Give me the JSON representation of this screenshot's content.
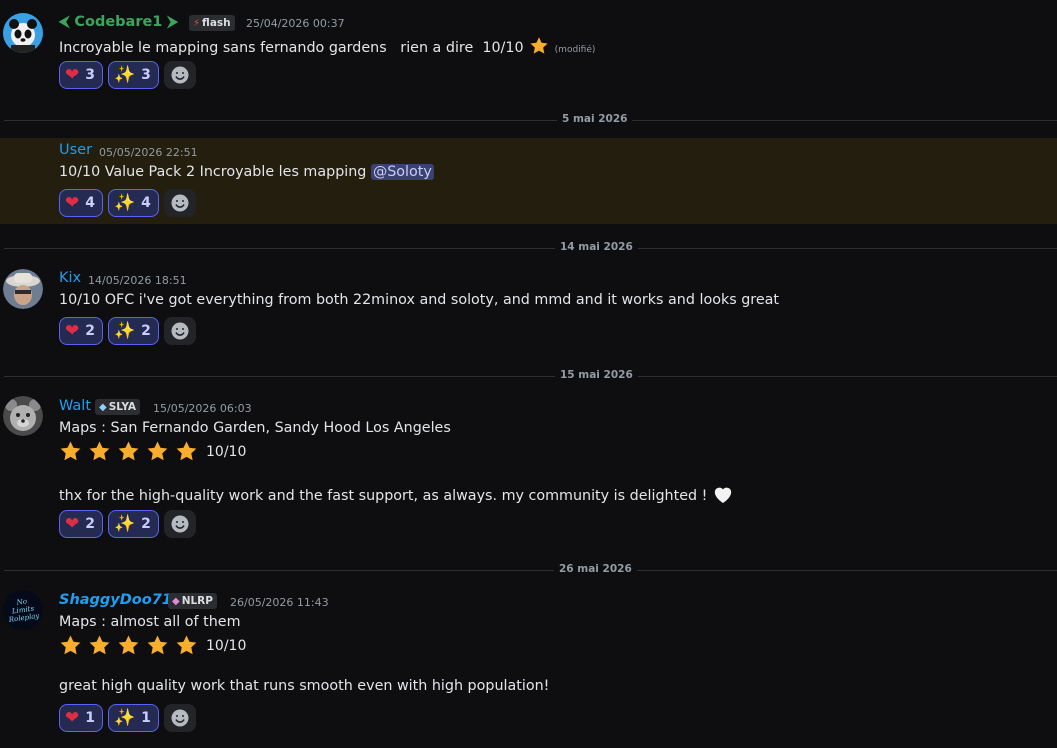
{
  "colors": {
    "bg": "#0e0e10",
    "highlight_bg": "#231e0e",
    "reaction_border": "#5865f2",
    "star": "#f8ae2d",
    "green_name": "#3ba55d",
    "blue_name": "#1e9ff0"
  },
  "messages": [
    {
      "avatar_icon": "panda-avatar-icon",
      "username": "⮜ Codebare1 ⮞",
      "badge": {
        "icon": "lightning-icon",
        "label": "flash"
      },
      "timestamp": "25/04/2026 00:37",
      "text": "Incroyable le mapping sans fernando gardens   rien a dire  10/10",
      "edited": "(modifié)",
      "reactions": [
        {
          "emoji": "heart-icon",
          "count": "3"
        },
        {
          "emoji": "sparkles-icon",
          "count": "3"
        }
      ]
    },
    {
      "username": "User",
      "timestamp": "05/05/2026 22:51",
      "text": "10/10 Value Pack 2 Incroyable les mapping ",
      "mention": "@Soloty",
      "reactions": [
        {
          "emoji": "heart-icon",
          "count": "4"
        },
        {
          "emoji": "sparkles-icon",
          "count": "4"
        }
      ]
    },
    {
      "avatar_icon": "cowboy-avatar-icon",
      "username": "Kix",
      "timestamp": "14/05/2026 18:51",
      "text": "10/10 OFC i've got everything from both 22minox and soloty, and mmd and it works and looks great",
      "reactions": [
        {
          "emoji": "heart-icon",
          "count": "2"
        },
        {
          "emoji": "sparkles-icon",
          "count": "2"
        }
      ]
    },
    {
      "avatar_icon": "bear-avatar-icon",
      "username": "Walt",
      "badge": {
        "icon": "diamond-icon",
        "label": "SLYA"
      },
      "timestamp": "15/05/2026 06:03",
      "line1": "Maps : San Fernando Garden, Sandy Hood Los Angeles",
      "stars": 5,
      "rating": "10/10",
      "line2": "thx for the high-quality work and the fast support, as always. my community is delighted ! ",
      "reactions": [
        {
          "emoji": "heart-icon",
          "count": "2"
        },
        {
          "emoji": "sparkles-icon",
          "count": "2"
        }
      ]
    },
    {
      "avatar_icon": "no-limits-roleplay-logo",
      "avatar_text": "No Limits Roleplay",
      "username": "ShaggyDoo710",
      "badge": {
        "icon": "gem-icon",
        "label": "NLRP"
      },
      "timestamp": "26/05/2026 11:43",
      "line1": "Maps : almost all of them",
      "stars": 5,
      "rating": "10/10",
      "line2": "great high quality work that runs smooth even with high population!",
      "reactions": [
        {
          "emoji": "heart-icon",
          "count": "1"
        },
        {
          "emoji": "sparkles-icon",
          "count": "1"
        }
      ]
    }
  ],
  "separators": [
    "5 mai 2026",
    "14 mai 2026",
    "15 mai 2026",
    "26 mai 2026"
  ]
}
